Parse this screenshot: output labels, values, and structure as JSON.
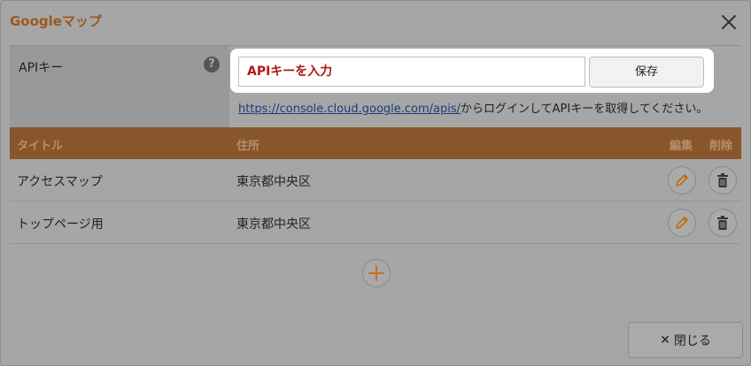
{
  "dialog": {
    "title": "Googleマップ",
    "close_icon": "close-icon"
  },
  "api": {
    "label": "APIキー",
    "help_icon": "question-icon",
    "help_glyph": "?",
    "input_value": "APIキーを入力",
    "save_label": "保存",
    "help_link": "https://console.cloud.google.com/apis/",
    "help_text": "からログインしてAPIキーを取得してください。"
  },
  "table": {
    "headers": {
      "title": "タイトル",
      "address": "住所",
      "edit": "編集",
      "delete": "削除"
    },
    "rows": [
      {
        "title": "アクセスマップ",
        "address": "東京都中央区"
      },
      {
        "title": "トップページ用",
        "address": "東京都中央区"
      }
    ]
  },
  "footer": {
    "close_label": "閉じる",
    "close_glyph": "✕"
  },
  "colors": {
    "accent": "#87562b",
    "title": "#9a5a1e",
    "icon_orange": "#c46a12",
    "input_text": "#b01818"
  }
}
